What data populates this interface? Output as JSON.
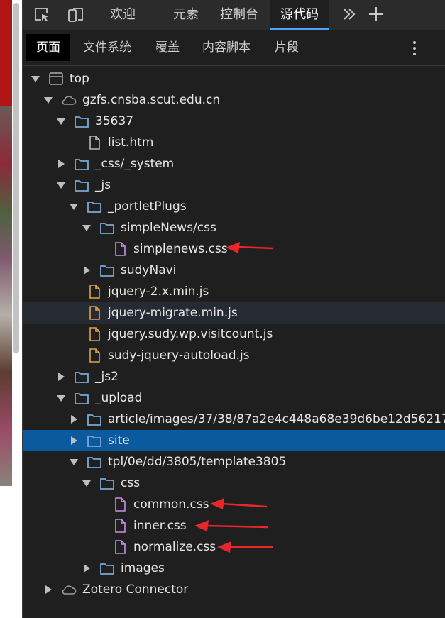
{
  "topbar": {
    "tabs": [
      "欢迎",
      "元素",
      "控制台",
      "源代码"
    ],
    "active_tab": "源代码"
  },
  "subbar": {
    "tabs": [
      "页面",
      "文件系统",
      "覆盖",
      "内容脚本",
      "片段"
    ],
    "active_tab": "页面"
  },
  "tree": [
    {
      "label": "top",
      "type": "frame"
    },
    {
      "label": "gzfs.cnsba.scut.edu.cn",
      "type": "cloud"
    },
    {
      "label": "35637",
      "type": "folder"
    },
    {
      "label": "list.htm",
      "type": "file-doc"
    },
    {
      "label": "_css/_system",
      "type": "folder"
    },
    {
      "label": "_js",
      "type": "folder"
    },
    {
      "label": "_portletPlugs",
      "type": "folder"
    },
    {
      "label": "simpleNews/css",
      "type": "folder"
    },
    {
      "label": "simplenews.css",
      "type": "file-css",
      "annotated": true
    },
    {
      "label": "sudyNavi",
      "type": "folder"
    },
    {
      "label": "jquery-2.x.min.js",
      "type": "file-js"
    },
    {
      "label": "jquery-migrate.min.js",
      "type": "file-js",
      "hover": true
    },
    {
      "label": "jquery.sudy.wp.visitcount.js",
      "type": "file-js"
    },
    {
      "label": "sudy-jquery-autoload.js",
      "type": "file-js"
    },
    {
      "label": "_js2",
      "type": "folder"
    },
    {
      "label": "_upload",
      "type": "folder"
    },
    {
      "label": "article/images/37/38/87a2e4c448a68e39d6be12d56217",
      "type": "folder"
    },
    {
      "label": "site",
      "type": "folder",
      "selected": true
    },
    {
      "label": "tpl/0e/dd/3805/template3805",
      "type": "folder"
    },
    {
      "label": "css",
      "type": "folder"
    },
    {
      "label": "common.css",
      "type": "file-css",
      "annotated": true
    },
    {
      "label": "inner.css",
      "type": "file-css",
      "annotated": true
    },
    {
      "label": "normalize.css",
      "type": "file-css",
      "annotated": true
    },
    {
      "label": "images",
      "type": "folder"
    },
    {
      "label": "Zotero Connector",
      "type": "cloud"
    }
  ],
  "icons": {
    "inspect": "inspect-icon",
    "device": "device-emulation-icon",
    "more_tabs": "double-chevron-icon",
    "add_tab": "plus-icon",
    "more_options": "kebab-menu-icon"
  },
  "colors": {
    "selected_row": "#0b5a9e",
    "folder_icon": "#7aa7d6",
    "css_file_icon": "#c891e8",
    "js_file_icon": "#e2a24a",
    "annotation_arrow": "#e8262b"
  }
}
